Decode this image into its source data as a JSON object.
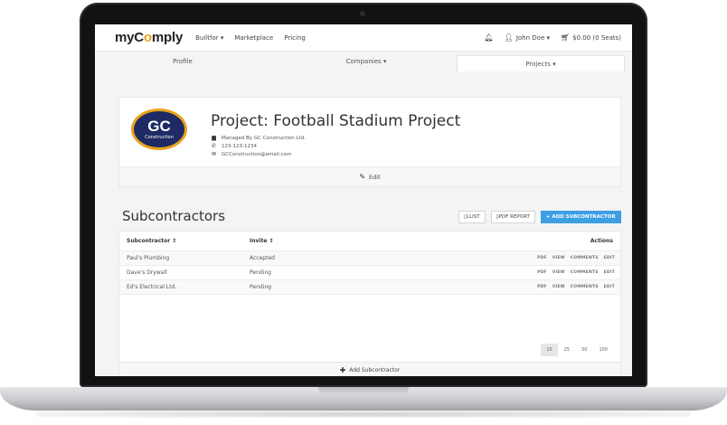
{
  "navbar": {
    "brand_prefix": "myC",
    "brand_o": "o",
    "brand_suffix": "mply",
    "links": [
      "Builtfor ▾",
      "Marketplace",
      "Pricing"
    ],
    "user": "John Doe ▾",
    "cart": "$0.00 (0 Seats)"
  },
  "tabs": {
    "profile": "Profile",
    "companies": "Companies ▾",
    "projects": "Projects ▾"
  },
  "project": {
    "logo_text": "GC",
    "logo_subtext": "Construction",
    "title": "Project: Football Stadium Project",
    "managed_by": "Managed By GC Construction Ltd.",
    "phone": "123-123-1234",
    "email": "GCConstruction@email.com",
    "edit_label": "Edit"
  },
  "subcontractors": {
    "title": "Subcontractors",
    "btn_list": "LLIST",
    "btn_pdf_report": "PDF REPORT",
    "btn_add": "+ ADD SUBCONTRACTOR",
    "headers": {
      "subcontractor": "Subcontractor ↕",
      "invite": "Invite ↕",
      "actions": "Actions"
    },
    "rows": [
      {
        "name": "Paul's Plumbing",
        "invite": "Accepted"
      },
      {
        "name": "Dave's Drywall",
        "invite": "Pending"
      },
      {
        "name": "Ed's Electrical Ltd.",
        "invite": "Pending"
      }
    ],
    "row_actions": [
      "PDF",
      "VIEW",
      "COMMENTS",
      "EDIT"
    ],
    "page_sizes": [
      "10",
      "25",
      "50",
      "100"
    ],
    "add_label": "Add Subcontractor"
  },
  "colors": {
    "accent_blue": "#3d9ee4",
    "logo_navy": "#1d2a63",
    "logo_gold": "#e9a21a"
  },
  "icons": {
    "bell": "bell-icon",
    "user": "user-icon",
    "cart": "cart-icon",
    "building": "building-icon",
    "phone": "phone-icon",
    "envelope": "envelope-icon",
    "pencil": "pencil-icon",
    "plus": "plus-icon"
  }
}
